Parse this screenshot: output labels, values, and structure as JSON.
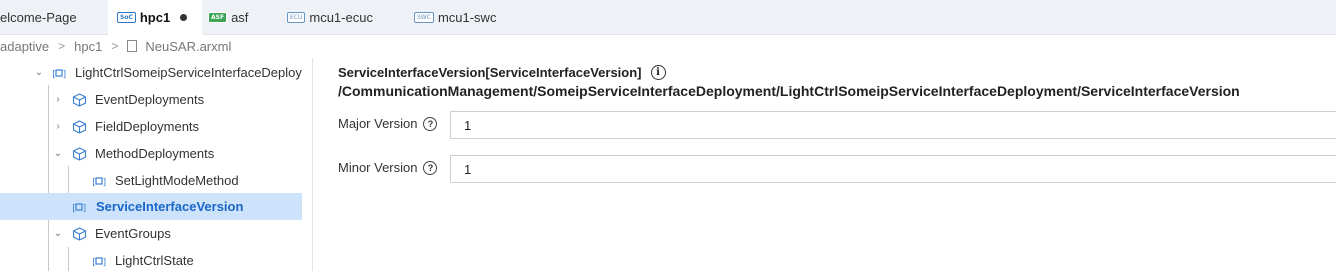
{
  "tabs": [
    {
      "label": "elcome-Page",
      "badge": "",
      "active": false,
      "modified": false
    },
    {
      "label": "hpc1",
      "badge": "SoC",
      "active": true,
      "modified": true
    },
    {
      "label": "asf",
      "badge": "ASF",
      "active": false,
      "modified": false
    },
    {
      "label": "mcu1-ecuc",
      "badge": "ECU",
      "active": false,
      "modified": false
    },
    {
      "label": "mcu1-swc",
      "badge": "SWC",
      "active": false,
      "modified": false
    }
  ],
  "breadcrumb": {
    "items": [
      "adaptive",
      "hpc1",
      "NeuSAR.arxml"
    ],
    "separator": ">"
  },
  "tree": {
    "items": [
      {
        "label": "LightCtrlSomeipServiceInterfaceDeploy",
        "expanded": true,
        "icon": "element-icon"
      },
      {
        "label": "EventDeployments",
        "expanded": false,
        "icon": "cube-icon"
      },
      {
        "label": "FieldDeployments",
        "expanded": false,
        "icon": "cube-icon"
      },
      {
        "label": "MethodDeployments",
        "expanded": true,
        "icon": "cube-icon"
      },
      {
        "label": "SetLightModeMethod",
        "icon": "element-icon"
      },
      {
        "label": "ServiceInterfaceVersion",
        "icon": "element-icon",
        "selected": true
      },
      {
        "label": "EventGroups",
        "expanded": true,
        "icon": "cube-icon"
      },
      {
        "label": "LightCtrlState",
        "icon": "element-icon"
      }
    ]
  },
  "details": {
    "title": "ServiceInterfaceVersion[ServiceInterfaceVersion]",
    "path": "/CommunicationManagement/SomeipServiceInterfaceDeployment/LightCtrlSomeipServiceInterfaceDeployment/ServiceInterfaceVersion",
    "fields": [
      {
        "label": "Major Version",
        "value": "1"
      },
      {
        "label": "Minor Version",
        "value": "1"
      }
    ]
  },
  "colors": {
    "selected_bg": "#cde3fb",
    "selected_text": "#1a66c8",
    "tabbar_bg": "#eef1f5",
    "icon_blue": "#3a7fd0"
  }
}
